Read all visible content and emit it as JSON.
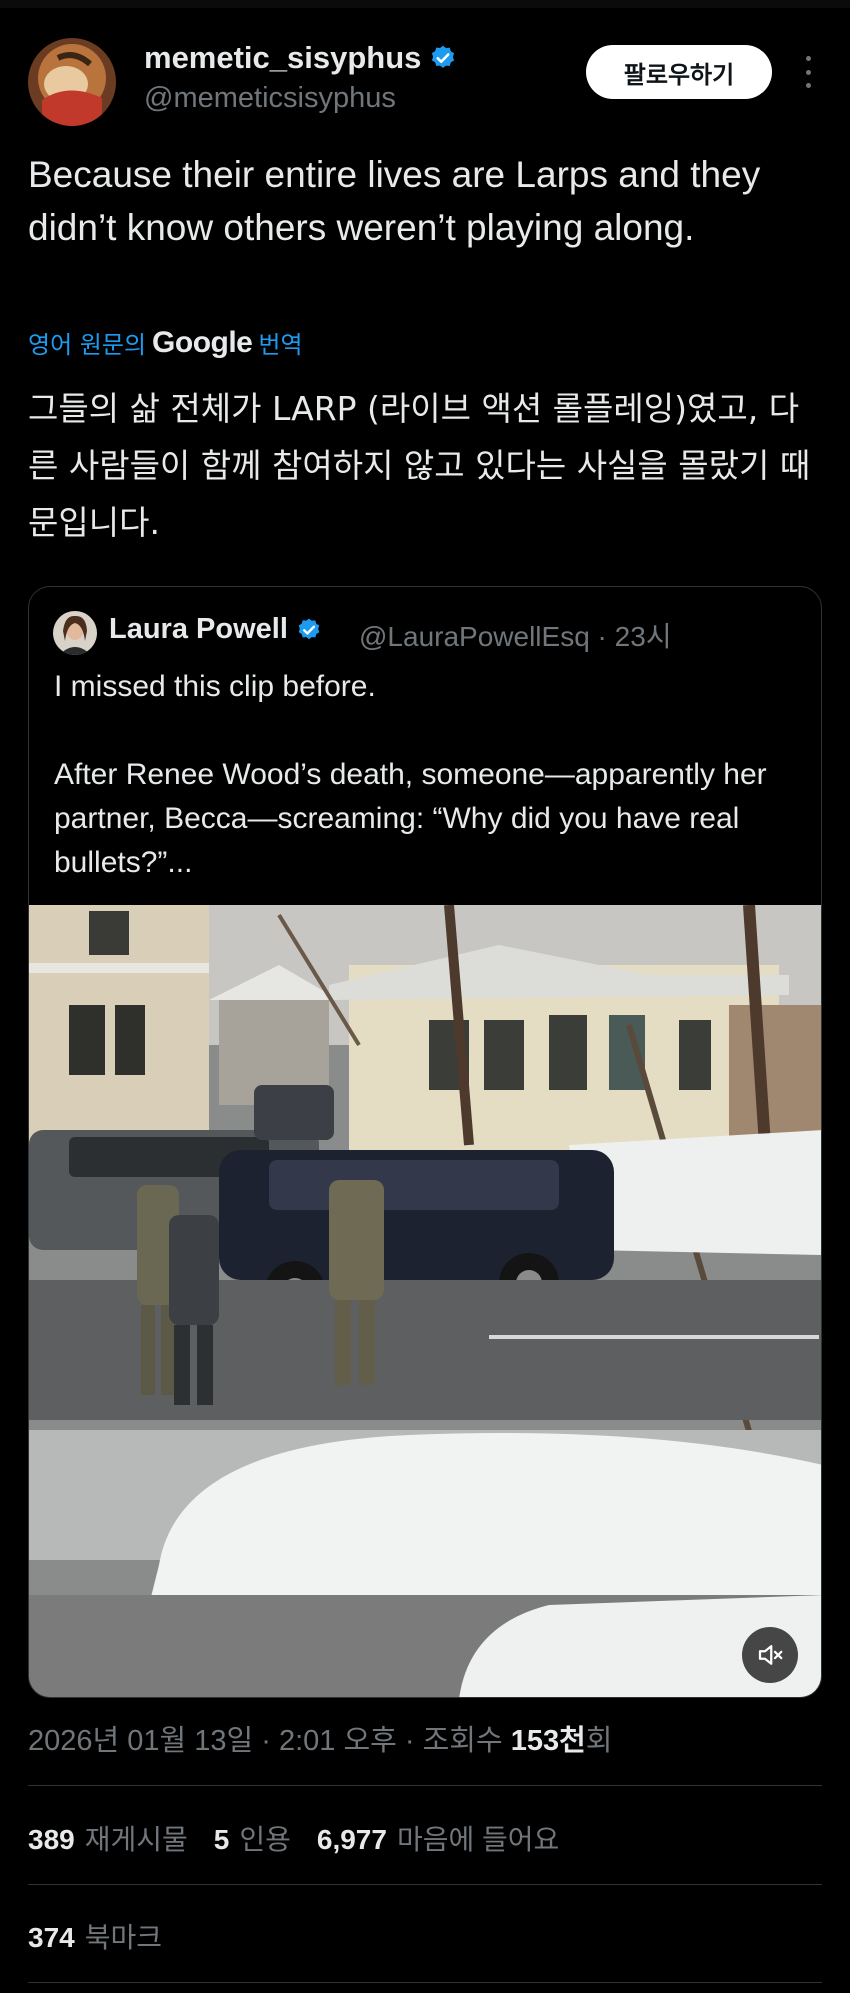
{
  "author": {
    "name": "memetic_sisyphus",
    "handle": "@memeticsisyphus",
    "verified": true,
    "follow_label": "팔로우하기"
  },
  "tweet": {
    "text": "Because their entire lives are Larps and they didn’t know others weren’t playing along.",
    "translation_prefix": "영어 원문의",
    "translation_brand": "Google",
    "translation_suffix": "번역",
    "translated_text": "그들의 삶 전체가 LARP (라이브 액션 롤플레잉)였고, 다른 사람들이 함께 참여하지 않고 있다는 사실을 몰랐기 때문입니다."
  },
  "quoted": {
    "name": "Laura Powell",
    "handle": "@LauraPowellEsq",
    "time": "23시",
    "verified": true,
    "line1": "I missed this clip before.",
    "line2": "After Renee Wood’s death, someone—apparently her partner, Becca—screaming: “Why did you have real bullets?”...",
    "media_icon": "mute-icon"
  },
  "meta": {
    "timestamp": "2026년 01월 13일 · 2:01 오후 · 조회수",
    "views": "153천",
    "views_suffix": "회"
  },
  "stats": {
    "retweets": "389",
    "retweets_label": "재게시물",
    "quotes": "5",
    "quotes_label": "인용",
    "likes": "6,977",
    "likes_label": "마음에 들어요",
    "bookmarks": "374",
    "bookmarks_label": "북마크"
  },
  "colors": {
    "accent": "#1d9bf0",
    "text": "#e7e9ea",
    "muted": "#71767b",
    "background": "#000000",
    "border": "#2f3336"
  }
}
